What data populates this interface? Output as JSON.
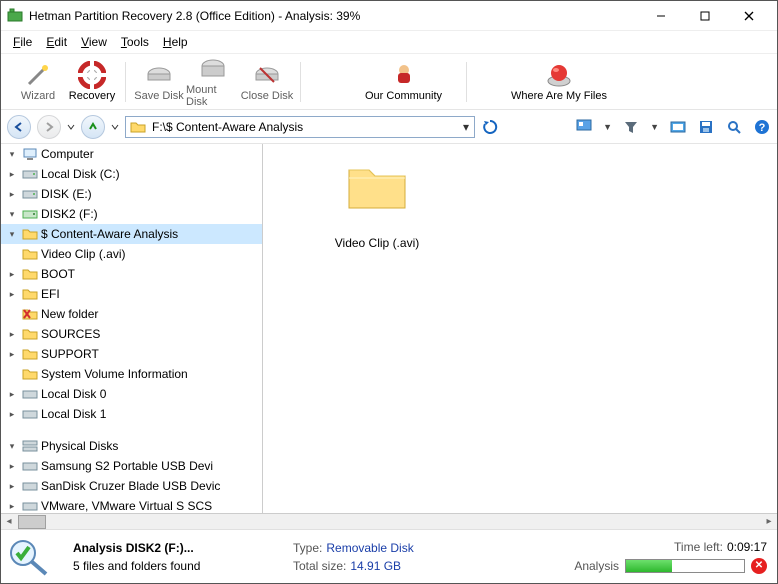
{
  "title": "Hetman Partition Recovery 2.8 (Office Edition) - Analysis: 39%",
  "menu": {
    "file": "File",
    "edit": "Edit",
    "view": "View",
    "tools": "Tools",
    "help": "Help"
  },
  "toolbar": {
    "wizard": "Wizard",
    "recovery": "Recovery",
    "save_disk": "Save Disk",
    "mount_disk": "Mount Disk",
    "close_disk": "Close Disk",
    "community": "Our Community",
    "whereFiles": "Where Are My Files"
  },
  "address": {
    "path": "F:\\$ Content-Aware Analysis"
  },
  "tree": {
    "computer": "Computer",
    "local_c": "Local Disk (C:)",
    "disk_e": "DISK (E:)",
    "disk2_f": "DISK2 (F:)",
    "content_aware": "$ Content-Aware Analysis",
    "video_clip": "Video Clip (.avi)",
    "boot": "BOOT",
    "efi": "EFI",
    "new_folder": "New folder",
    "sources": "SOURCES",
    "support": "SUPPORT",
    "sysvol": "System Volume Information",
    "local0": "Local Disk 0",
    "local1": "Local Disk 1",
    "physical": "Physical Disks",
    "samsung": "Samsung S2 Portable USB Devi",
    "sandisk": "SanDisk Cruzer Blade USB Devic",
    "vmware": "VMware, VMware Virtual S SCS"
  },
  "content": {
    "folder_caption": "Video Clip (.avi)"
  },
  "status": {
    "title": "Analysis DISK2 (F:)...",
    "found": "5 files and folders found",
    "type_lbl": "Type:",
    "type_val": "Removable Disk",
    "size_lbl": "Total size:",
    "size_val": "14.91 GB",
    "timeleft_lbl": "Time left:",
    "timeleft_val": "0:09:17",
    "analysis_lbl": "Analysis",
    "progress_percent": 39
  }
}
